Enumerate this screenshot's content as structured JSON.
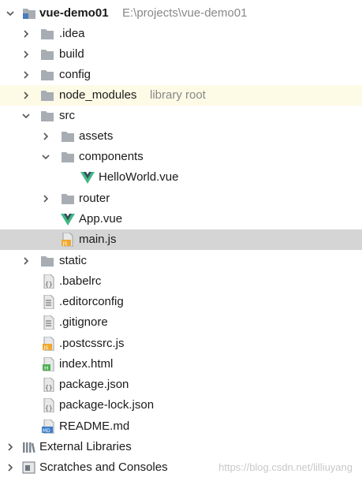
{
  "project": {
    "name": "vue-demo01",
    "path": "E:\\projects\\vue-demo01"
  },
  "tree": {
    "idea": ".idea",
    "build": "build",
    "config": "config",
    "node_modules": "node_modules",
    "node_modules_hint": "library root",
    "src": "src",
    "assets": "assets",
    "components": "components",
    "helloworld": "HelloWorld.vue",
    "router": "router",
    "app_vue": "App.vue",
    "main_js": "main.js",
    "static": "static",
    "babelrc": ".babelrc",
    "editorconfig": ".editorconfig",
    "gitignore": ".gitignore",
    "postcssrc": ".postcssrc.js",
    "index_html": "index.html",
    "package_json": "package.json",
    "package_lock": "package-lock.json",
    "readme": "README.md"
  },
  "external_libraries": "External Libraries",
  "scratches": "Scratches and Consoles",
  "watermark": "https://blog.csdn.net/lilliuyang",
  "icon_texts": {
    "js": "JS",
    "md": "MD",
    "h": "H",
    "braces": "{}"
  },
  "colors": {
    "folder": "#a7adb3",
    "vue_green": "#41b883",
    "vue_dark": "#35495e",
    "js_badge": "#f0a830",
    "selection": "#d5d5d5",
    "library_root_bg": "#fdfbe6"
  }
}
